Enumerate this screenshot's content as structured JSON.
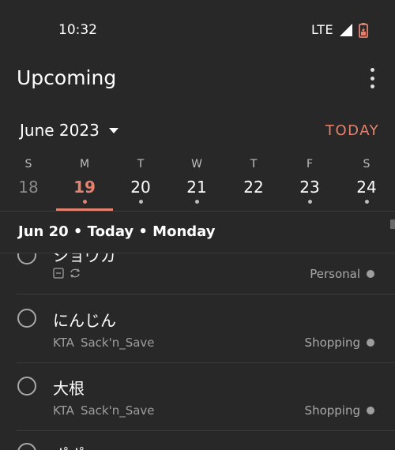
{
  "status_bar": {
    "time": "10:32",
    "network": "LTE"
  },
  "app_bar": {
    "title": "Upcoming",
    "menu_icon": "more-vert-icon"
  },
  "calendar": {
    "month_label": "June 2023",
    "today_label": "TODAY",
    "days": [
      {
        "dow": "S",
        "num": "18",
        "state": "past",
        "dot": false
      },
      {
        "dow": "M",
        "num": "19",
        "state": "selected",
        "dot": true
      },
      {
        "dow": "T",
        "num": "20",
        "state": "normal",
        "dot": true
      },
      {
        "dow": "W",
        "num": "21",
        "state": "normal",
        "dot": true
      },
      {
        "dow": "T",
        "num": "22",
        "state": "normal",
        "dot": false
      },
      {
        "dow": "F",
        "num": "23",
        "state": "normal",
        "dot": true
      },
      {
        "dow": "S",
        "num": "24",
        "state": "normal",
        "dot": true
      }
    ]
  },
  "section": {
    "label": "Jun 20 • Today • Monday"
  },
  "tasks": [
    {
      "name": "ショウガ",
      "meta": "",
      "icons": [
        "calendar-icon",
        "recurring-icon"
      ],
      "project": "Personal"
    },
    {
      "name": "にんじん",
      "meta_a": "KTA",
      "meta_b": "Sack'n_Save",
      "project": "Shopping"
    },
    {
      "name": "大根",
      "meta_a": "KTA",
      "meta_b": "Sack'n_Save",
      "project": "Shopping"
    },
    {
      "name": "ポポ"
    }
  ],
  "colors": {
    "accent": "#e5826f",
    "background": "#282828"
  }
}
